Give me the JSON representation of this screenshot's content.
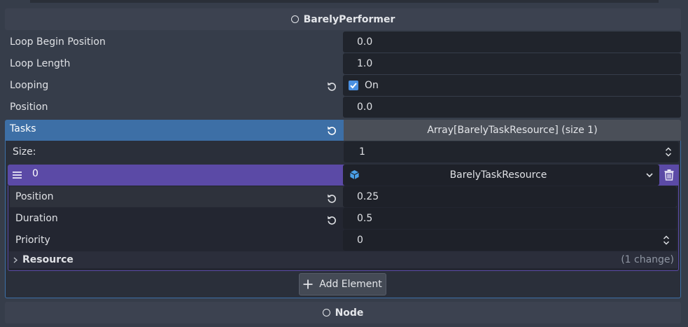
{
  "performer_section": {
    "title": "BarelyPerformer"
  },
  "properties": [
    {
      "label": "Loop Begin Position",
      "value": "0.0"
    },
    {
      "label": "Loop Length",
      "value": "1.0"
    },
    {
      "label": "Looping",
      "value": "On",
      "checked": true
    },
    {
      "label": "Position",
      "value": "0.0"
    }
  ],
  "tasks": {
    "label": "Tasks",
    "array_label": "Array[BarelyTaskResource] (size 1)",
    "size_label": "Size:",
    "size_value": "1",
    "element": {
      "index": "0",
      "resource_type": "BarelyTaskResource",
      "fields": [
        {
          "label": "Position",
          "value": "0.25"
        },
        {
          "label": "Duration",
          "value": "0.5"
        },
        {
          "label": "Priority",
          "value": "0"
        }
      ],
      "resource_label": "Resource",
      "resource_changes": "(1 change)"
    },
    "add_element_label": "Add Element"
  },
  "node_section": {
    "title": "Node"
  },
  "colors": {
    "accent_blue": "#3d6fa6",
    "accent_purple": "#5b4aa6",
    "checkbox": "#4a90e2",
    "resource_icon": "#4aa0e8"
  },
  "icons": [
    "circle-icon",
    "revert-icon",
    "checkbox-icon",
    "drag-handle-icon",
    "cube-icon",
    "chevron-down-icon",
    "trash-icon",
    "chevron-right-icon",
    "plus-icon",
    "spinner-icon"
  ]
}
